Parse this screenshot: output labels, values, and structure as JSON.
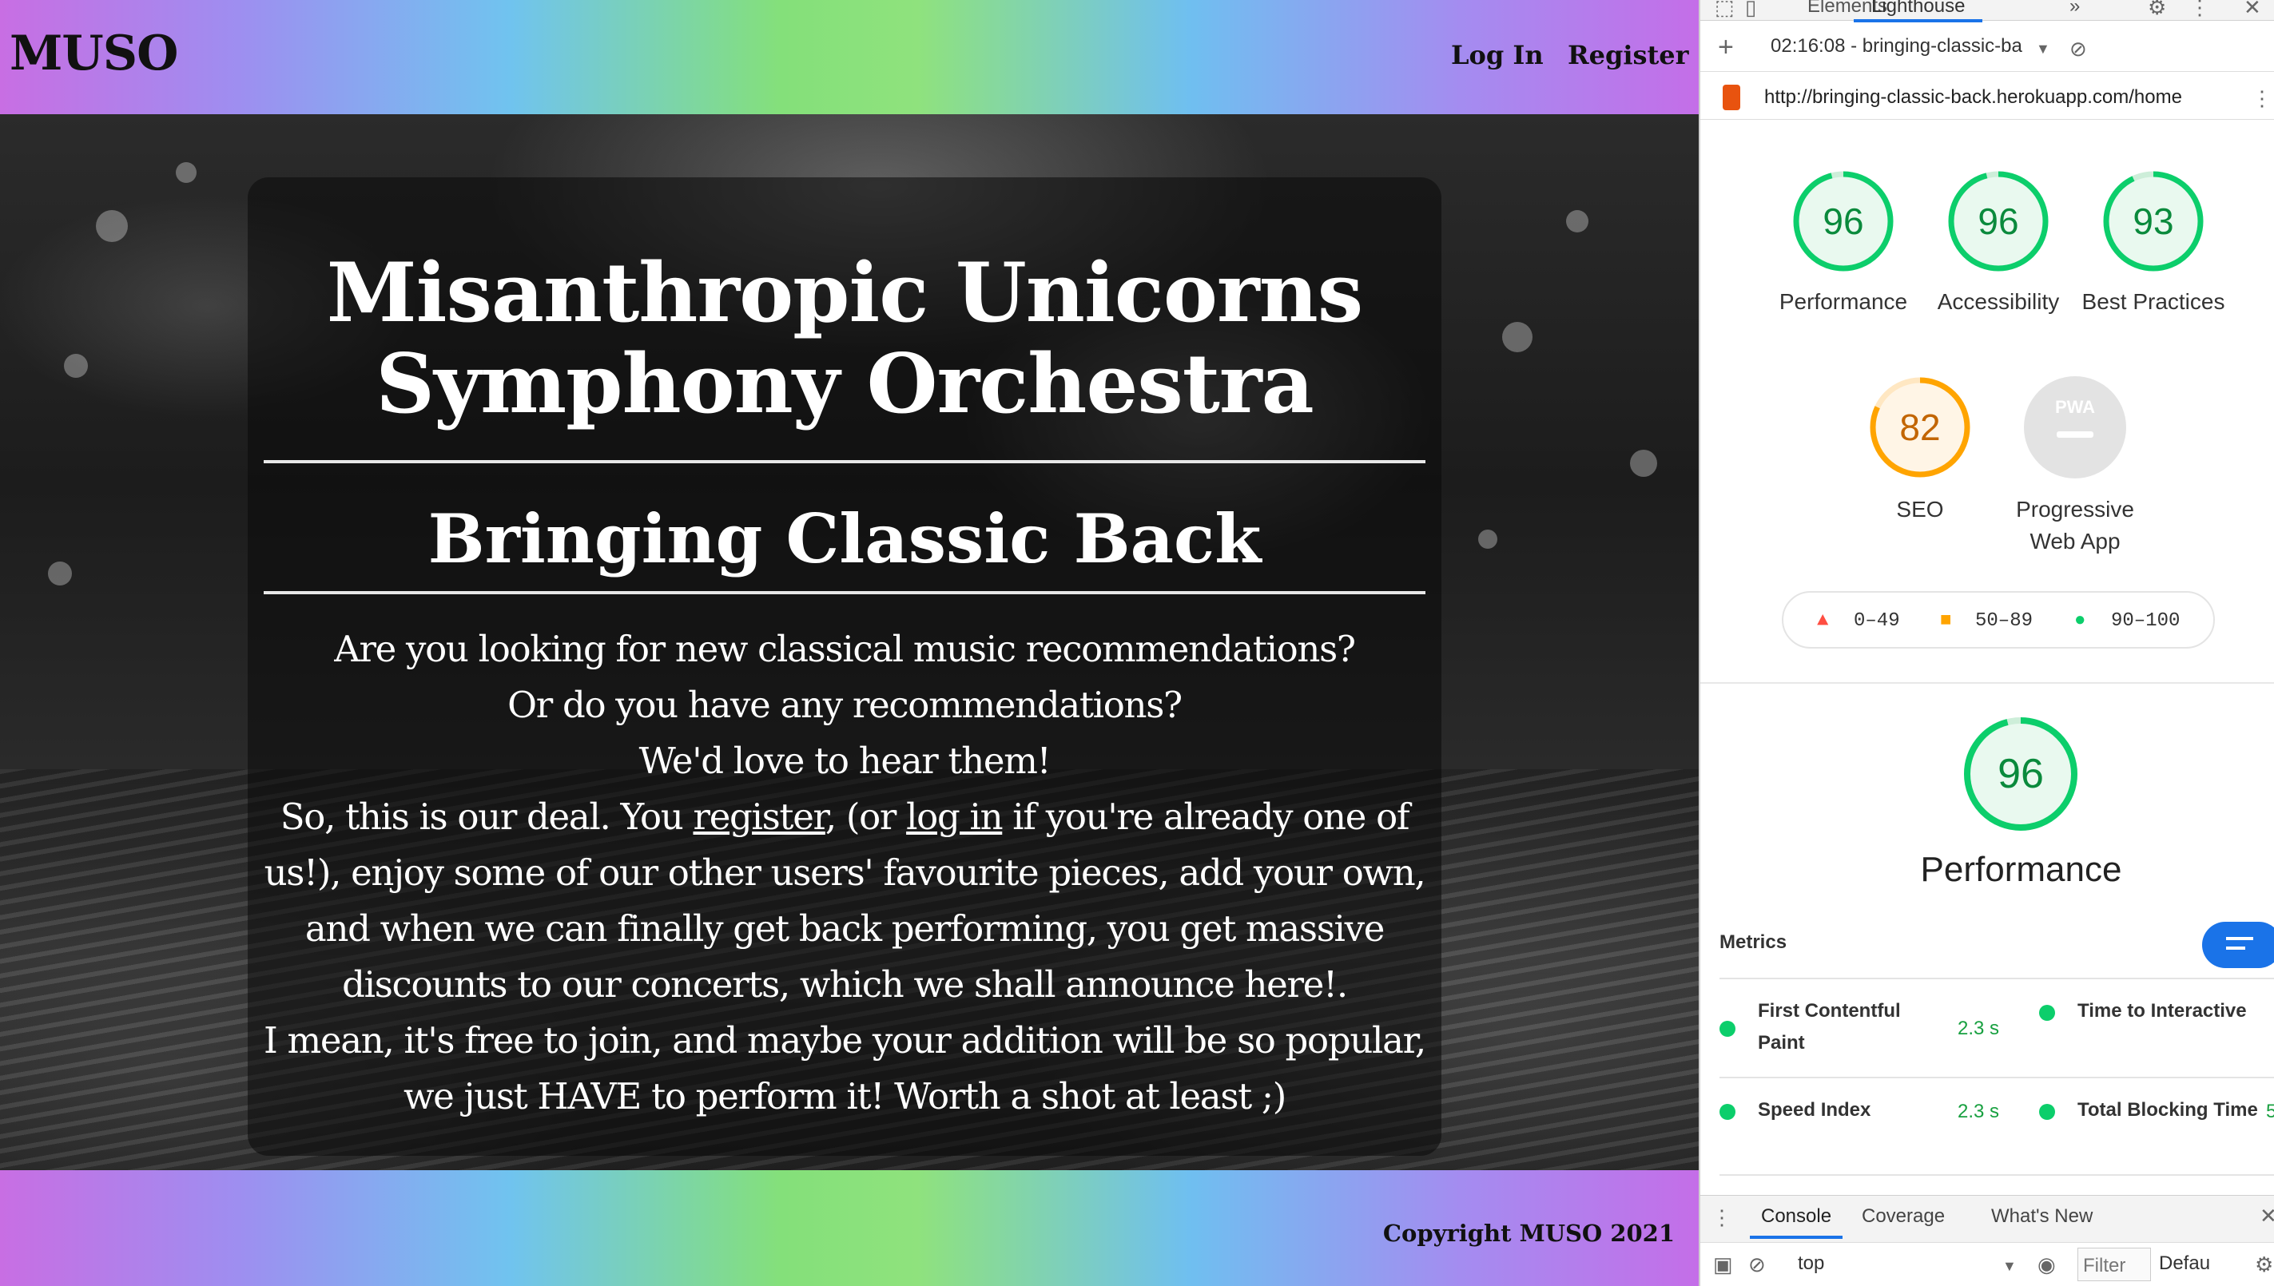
{
  "site": {
    "brand": "MUSO",
    "nav": {
      "login": "Log In",
      "register": "Register"
    },
    "hero": {
      "title_line1": "Misanthropic Unicorns",
      "title_line2": "Symphony Orchestra",
      "subtitle": "Bringing Classic Back",
      "line1": "Are you looking for new classical music recommendations?",
      "line2": "Or do you have any recommendations?",
      "line3": "We'd love to hear them!",
      "deal_prefix": "So, this is our deal. You ",
      "deal_register_link": "register",
      "deal_middle": ", (or ",
      "deal_login_link": "log in",
      "deal_rest": " if you're already one of us!), enjoy some of our other users' favourite pieces, add your own, and when we can finally get back performing, you get massive discounts to our concerts, which we shall announce here!.",
      "closing": "I mean, it's free to join, and maybe your addition will be so popular, we just HAVE to perform it! Worth a shot at least ;)"
    },
    "footer": {
      "copyright": "Copyright MUSO 2021"
    }
  },
  "devtools": {
    "tabs": {
      "elements": "Elements",
      "lighthouse": "Lighthouse",
      "more": "»"
    },
    "report_select": "02:16:08 - bringing-classic-ba",
    "url": "http://bringing-classic-back.herokuapp.com/home",
    "scores": [
      {
        "label": "Performance",
        "value": "96",
        "fraction": 0.96
      },
      {
        "label": "Accessibility",
        "value": "96",
        "fraction": 0.96
      },
      {
        "label": "Best Practices",
        "value": "93",
        "fraction": 0.93
      },
      {
        "label": "SEO",
        "value": "82",
        "fraction": 0.82
      },
      {
        "label": "Progressive Web App",
        "value": ""
      }
    ],
    "pwa_badge": "PWA",
    "legend": {
      "fail": "0–49",
      "average": "50–89",
      "pass": "90–100"
    },
    "main_score": {
      "value": "96",
      "label": "Performance",
      "fraction": 0.96
    },
    "metrics_label": "Metrics",
    "metrics": [
      {
        "name": "First Contentful Paint",
        "value": "2.3 s"
      },
      {
        "name": "Time to Interactive",
        "value": ""
      },
      {
        "name": "Speed Index",
        "value": "2.3 s"
      },
      {
        "name": "Total Blocking Time",
        "value": "5"
      }
    ],
    "drawer": {
      "tabs": {
        "console": "Console",
        "coverage": "Coverage",
        "whats_new": "What's New"
      },
      "context": "top",
      "filter_placeholder": "Filter",
      "levels": "Defau"
    },
    "colors": {
      "pass": "#0cce6b",
      "average": "#ffa400",
      "fail": "#ff4e42",
      "accent": "#1a73e8"
    }
  }
}
